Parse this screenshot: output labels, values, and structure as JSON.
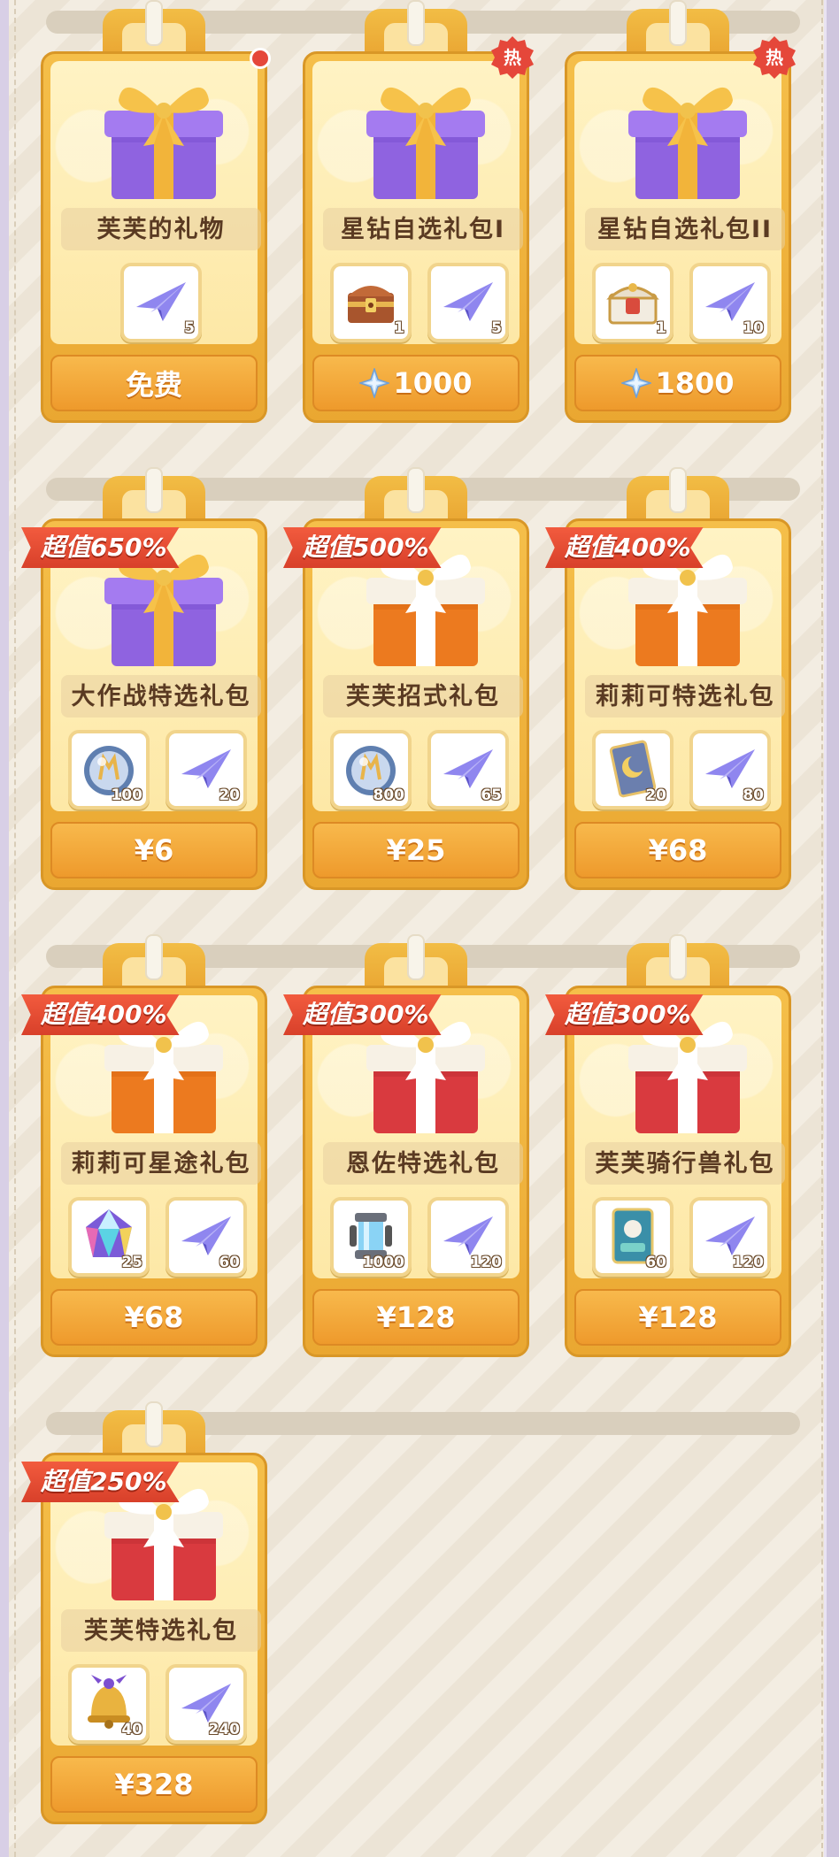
{
  "shop": {
    "rows": [
      {
        "cards": [
          {
            "name": "芙芙的礼物",
            "gift": "purple",
            "badge": "dot",
            "ribbon": "",
            "price": "免费",
            "price_icon": "",
            "items": [
              {
                "icon": "paper-plane-icon",
                "qty": "5"
              }
            ]
          },
          {
            "name": "星钻自选礼包I",
            "gift": "purple",
            "badge": "热",
            "ribbon": "",
            "price": "1000",
            "price_icon": "star-diamond-icon",
            "items": [
              {
                "icon": "treasure-chest-icon",
                "qty": "1"
              },
              {
                "icon": "paper-plane-icon",
                "qty": "5"
              }
            ]
          },
          {
            "name": "星钻自选礼包II",
            "gift": "purple",
            "badge": "热",
            "ribbon": "",
            "price": "1800",
            "price_icon": "star-diamond-icon",
            "items": [
              {
                "icon": "ornate-chest-icon",
                "qty": "1"
              },
              {
                "icon": "paper-plane-icon",
                "qty": "10"
              }
            ]
          }
        ]
      },
      {
        "cards": [
          {
            "name": "大作战特选礼包",
            "gift": "purple",
            "badge": "",
            "ribbon": "超值650%",
            "price": "¥6",
            "price_icon": "",
            "items": [
              {
                "icon": "crystal-orb-icon",
                "qty": "100"
              },
              {
                "icon": "paper-plane-icon",
                "qty": "20"
              }
            ]
          },
          {
            "name": "芙芙招式礼包",
            "gift": "orange",
            "badge": "",
            "ribbon": "超值500%",
            "price": "¥25",
            "price_icon": "",
            "items": [
              {
                "icon": "crystal-orb-icon",
                "qty": "800"
              },
              {
                "icon": "paper-plane-icon",
                "qty": "65"
              }
            ]
          },
          {
            "name": "莉莉可特选礼包",
            "gift": "orange",
            "badge": "",
            "ribbon": "超值400%",
            "price": "¥68",
            "price_icon": "",
            "items": [
              {
                "icon": "moon-card-icon",
                "qty": "20"
              },
              {
                "icon": "paper-plane-icon",
                "qty": "80"
              }
            ]
          }
        ]
      },
      {
        "cards": [
          {
            "name": "莉莉可星途礼包",
            "gift": "orange",
            "badge": "",
            "ribbon": "超值400%",
            "price": "¥68",
            "price_icon": "",
            "items": [
              {
                "icon": "rainbow-gem-icon",
                "qty": "25"
              },
              {
                "icon": "paper-plane-icon",
                "qty": "60"
              }
            ]
          },
          {
            "name": "恩佐特选礼包",
            "gift": "red",
            "badge": "",
            "ribbon": "超值300%",
            "price": "¥128",
            "price_icon": "",
            "items": [
              {
                "icon": "energy-canister-icon",
                "qty": "1000"
              },
              {
                "icon": "paper-plane-icon",
                "qty": "120"
              }
            ]
          },
          {
            "name": "芙芙骑行兽礼包",
            "gift": "red",
            "badge": "",
            "ribbon": "超值300%",
            "price": "¥128",
            "price_icon": "",
            "items": [
              {
                "icon": "mount-ticket-icon",
                "qty": "60"
              },
              {
                "icon": "paper-plane-icon",
                "qty": "120"
              }
            ]
          }
        ]
      },
      {
        "cards": [
          {
            "name": "芙芙特选礼包",
            "gift": "red",
            "badge": "",
            "ribbon": "超值250%",
            "price": "¥328",
            "price_icon": "",
            "items": [
              {
                "icon": "golden-bell-icon",
                "qty": "40"
              },
              {
                "icon": "paper-plane-icon",
                "qty": "240"
              }
            ]
          }
        ]
      }
    ]
  },
  "colors": {
    "accent_gold": "#f0b13c",
    "ribbon_red": "#e24a32",
    "hot_red": "#e5473a",
    "text_brown": "#5a3a22"
  }
}
